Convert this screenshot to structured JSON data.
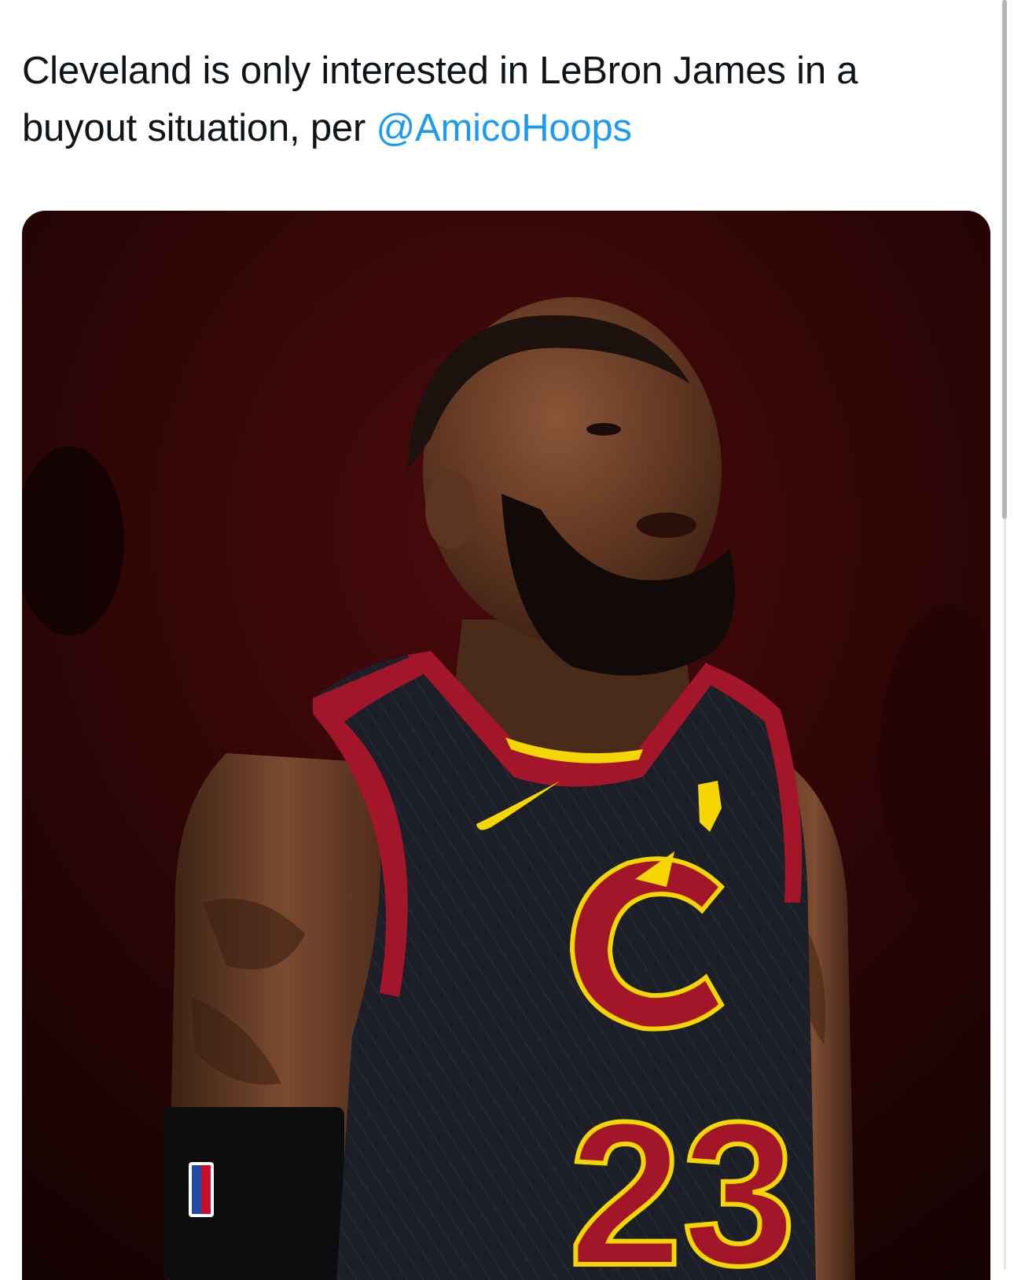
{
  "tweet": {
    "text": "Cleveland is only interested in LeBron James in a buyout situation, per ",
    "mention": "@AmicoHoops"
  },
  "media": {
    "icon": "player-photo",
    "jersey_number": "23",
    "jersey_logo": "C"
  },
  "colors": {
    "text": "#0f1419",
    "link": "#1d9bf0",
    "jersey_wine": "#a3162a",
    "jersey_gold": "#f5d600",
    "jersey_navy": "#1c1f27"
  }
}
